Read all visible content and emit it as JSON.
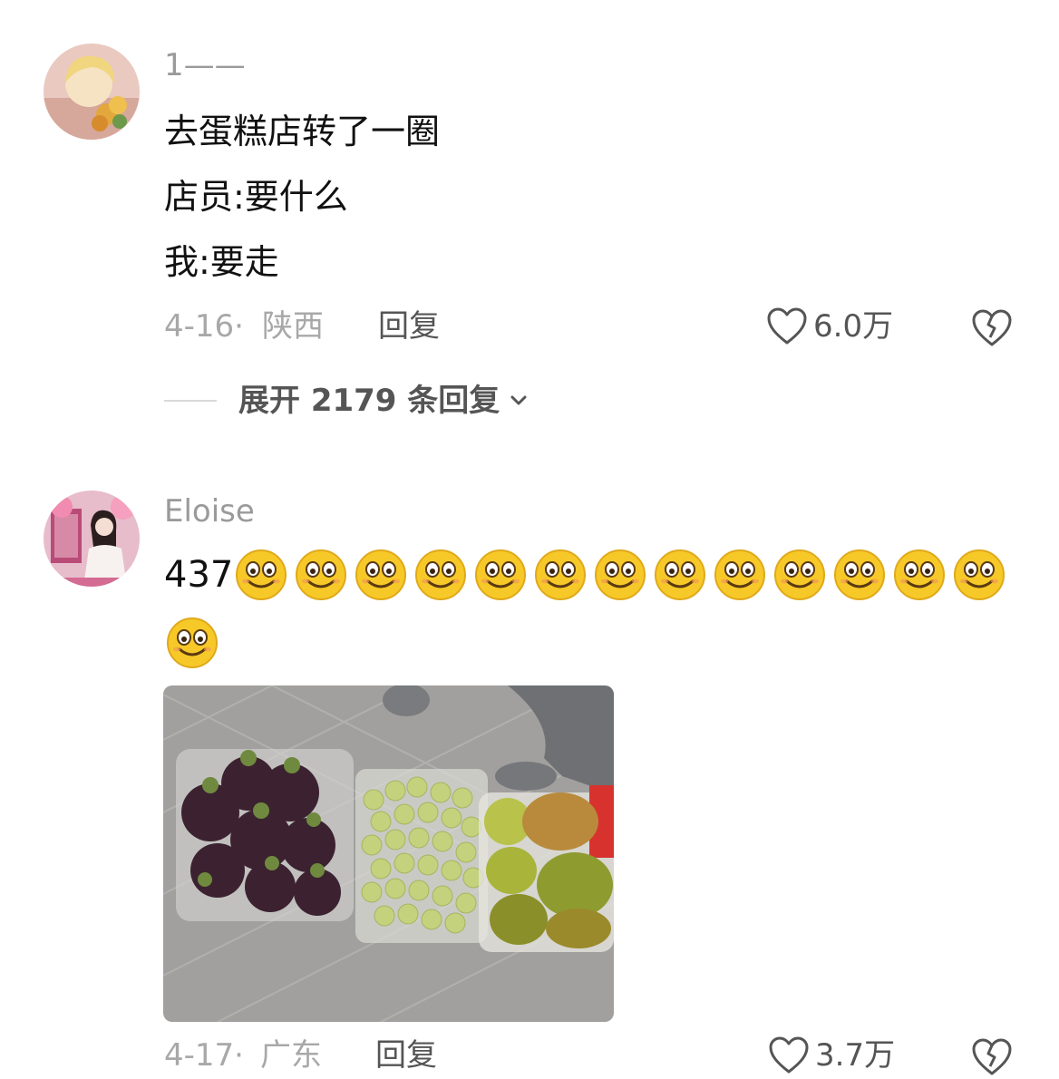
{
  "comments": [
    {
      "username": "1——",
      "lines": [
        "去蛋糕店转了一圈",
        "店员:要什么",
        "我:要走"
      ],
      "date": "4-16·",
      "location": "陕西",
      "reply_label": "回复",
      "likes": "6.0万",
      "expand_label": "展开 2179 条回复"
    },
    {
      "username": "Eloise",
      "number": "437",
      "emoji_name": "smile-emoji",
      "emoji_count": 14,
      "date": "4-17·",
      "location": "广东",
      "reply_label": "回复",
      "likes": "3.7万"
    }
  ],
  "colors": {
    "meta_gray": "#a8a8a8",
    "emoji_yellow": "#f7c928"
  }
}
